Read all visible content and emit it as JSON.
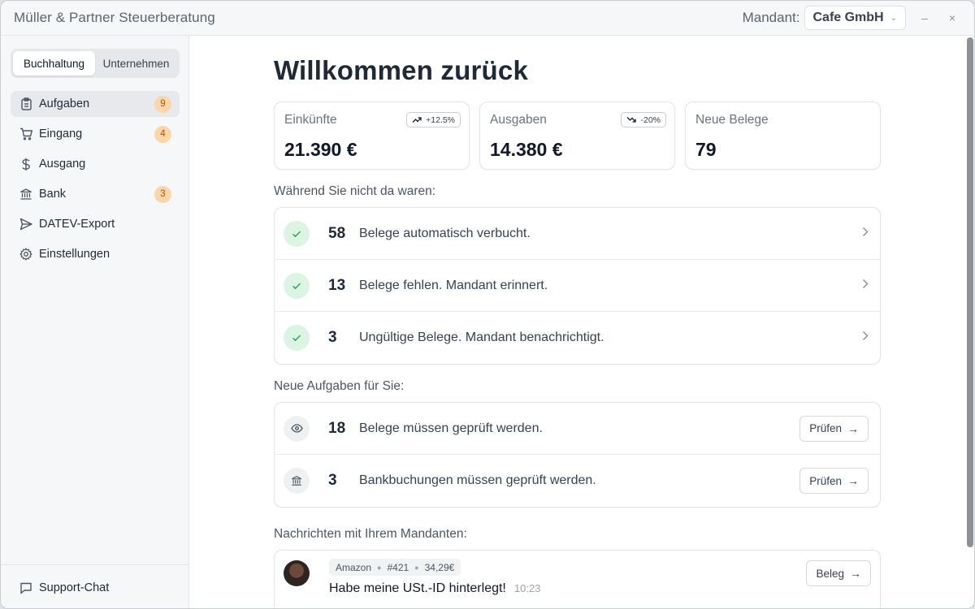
{
  "window": {
    "title": "Müller & Partner Steuerberatung",
    "mandant_label": "Mandant:",
    "mandant_value": "Cafe GmbH",
    "minimize": "–",
    "close": "×"
  },
  "sidebar": {
    "segments": [
      "Buchhaltung",
      "Unternehmen"
    ],
    "items": [
      {
        "label": "Aufgaben",
        "icon": "clipboard-icon",
        "badge": "9"
      },
      {
        "label": "Eingang",
        "icon": "cart-icon",
        "badge": "4"
      },
      {
        "label": "Ausgang",
        "icon": "dollar-icon",
        "badge": ""
      },
      {
        "label": "Bank",
        "icon": "bank-icon",
        "badge": "3"
      },
      {
        "label": "DATEV-Export",
        "icon": "send-icon",
        "badge": ""
      },
      {
        "label": "Einstellungen",
        "icon": "gear-icon",
        "badge": ""
      }
    ],
    "support": "Support-Chat"
  },
  "main": {
    "title": "Willkommen zurück",
    "stats": [
      {
        "label": "Einkünfte",
        "value": "21.390 €",
        "trend": "+12.5%",
        "trend_dir": "up"
      },
      {
        "label": "Ausgaben",
        "value": "14.380 €",
        "trend": "-20%",
        "trend_dir": "down"
      },
      {
        "label": "Neue Belege",
        "value": "79"
      }
    ],
    "away_label": "Während Sie nicht da waren:",
    "away": [
      {
        "num": "58",
        "text": "Belege automatisch verbucht."
      },
      {
        "num": "13",
        "text": "Belege fehlen. Mandant erinnert."
      },
      {
        "num": "3",
        "text": "Ungültige Belege. Mandant benachrichtigt."
      }
    ],
    "tasks_label": "Neue Aufgaben für Sie:",
    "tasks": [
      {
        "num": "18",
        "text": "Belege müssen geprüft werden.",
        "button": "Prüfen",
        "icon": "eye-icon"
      },
      {
        "num": "3",
        "text": "Bankbuchungen müssen geprüft werden.",
        "button": "Prüfen",
        "icon": "bank-icon"
      }
    ],
    "messages_label": "Nachrichten mit Ihrem Mandanten:",
    "messages": [
      {
        "vendor": "Amazon",
        "id": "#421",
        "amount": "34,29€",
        "text": "Habe meine USt.-ID hinterlegt!",
        "time": "10:23",
        "button": "Beleg"
      }
    ]
  },
  "colors": {
    "badge_bg": "#fbd6a8",
    "badge_text": "#b45309",
    "success_bg": "#dcf5e3",
    "success_icon": "#2f9e5b"
  }
}
